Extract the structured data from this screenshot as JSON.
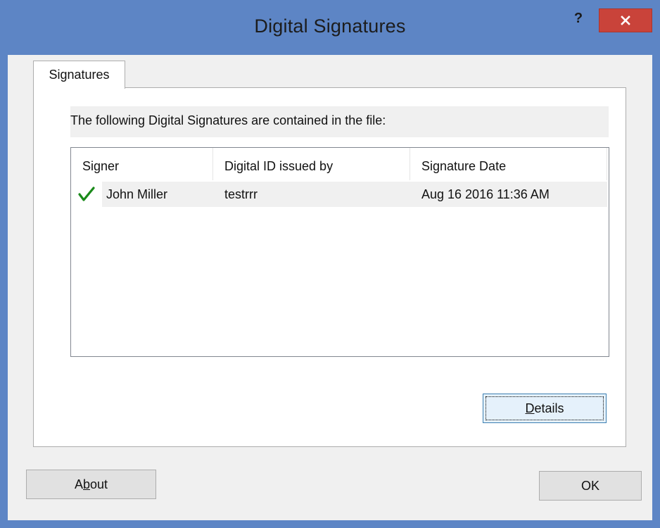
{
  "window": {
    "title": "Digital Signatures",
    "help_label": "?",
    "accent_color": "#5d85c5",
    "close_color": "#c9433a"
  },
  "tabs": [
    {
      "label": "Signatures",
      "selected": true
    }
  ],
  "panel": {
    "info_text": "The following Digital Signatures are contained in the file:",
    "columns": [
      "Signer",
      "Digital ID issued by",
      "Signature Date"
    ],
    "rows": [
      {
        "status_icon": "check-icon",
        "signer": "John Miller",
        "issued_by": "testrrr",
        "date": "Aug 16 2016 11:36 AM"
      }
    ],
    "details_button": {
      "label": "Details",
      "mnemonic": "D",
      "rest": "etails"
    }
  },
  "footer": {
    "about_button": {
      "label": "About",
      "prefix": "A",
      "mnemonic": "b",
      "rest": "out"
    },
    "ok_button": {
      "label": "OK"
    }
  }
}
